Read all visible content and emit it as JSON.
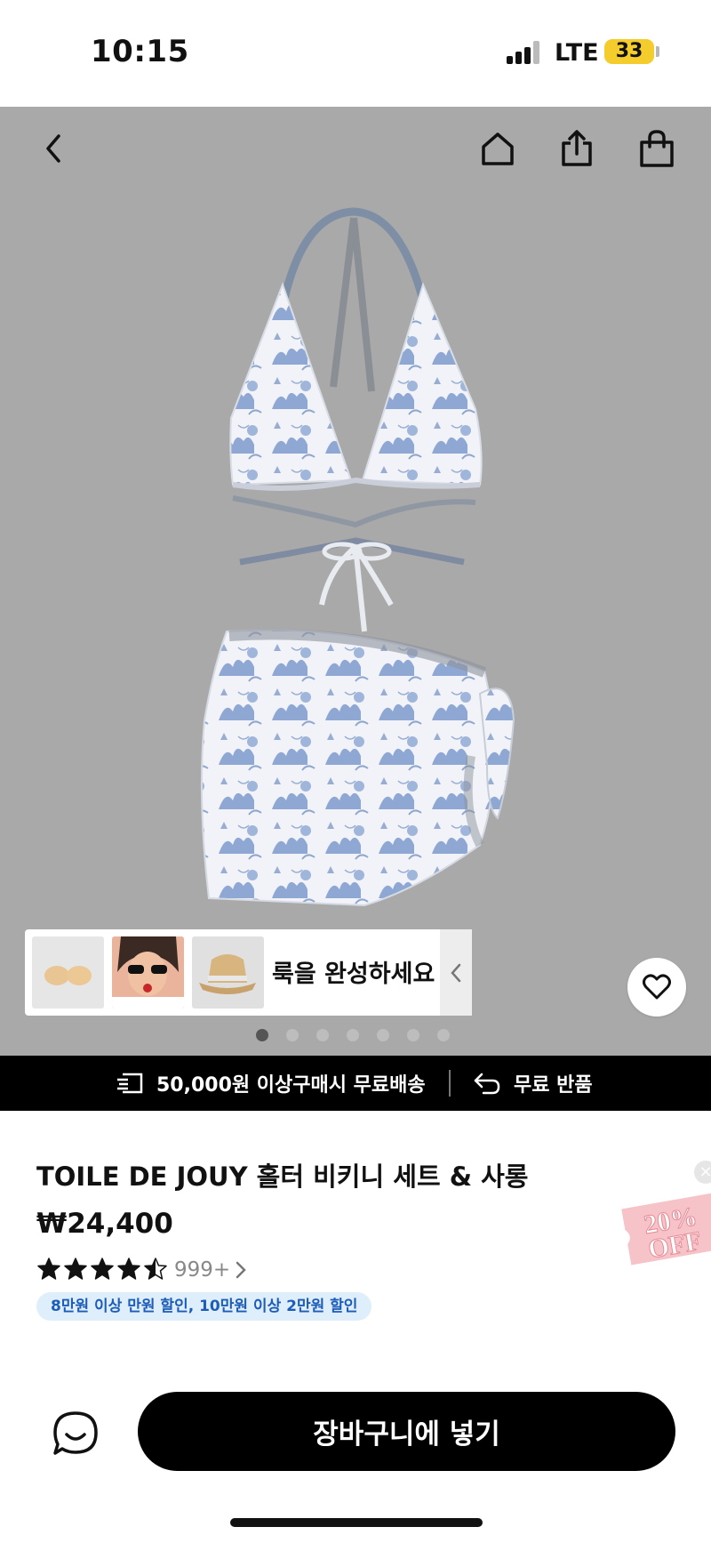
{
  "status_bar": {
    "time": "10:15",
    "network": "LTE",
    "battery": "33"
  },
  "nav": {
    "back_icon": "chevron-left-icon",
    "home_icon": "home-icon",
    "share_icon": "share-icon",
    "bag_icon": "shopping-bag-icon"
  },
  "outfit_strip": {
    "label": "룩을 완성하세요",
    "thumbnails": [
      "nude-bra-pads",
      "model-with-sunglasses",
      "straw-bucket-hat"
    ]
  },
  "carousel": {
    "total": 7,
    "active_index": 0
  },
  "promo": {
    "shipping": "50,000원 이상구매시 무료배송",
    "returns": "무료 반품"
  },
  "product": {
    "title": "TOILE DE JOUY 홀터 비키니 세트 & 사롱",
    "price": "₩24,400",
    "rating": 4.5,
    "reviews": "999+",
    "discount": "8만원 이상 만원 할인, 10만원 이상 2만원 할인"
  },
  "coupon": {
    "line1": "20%",
    "line2": "OFF"
  },
  "actions": {
    "add_to_cart": "장바구니에 넣기"
  },
  "colors": {
    "hero_bg": "#a9a9a9",
    "print_blue": "#5b7fb8",
    "discount_text": "#1d5db8",
    "discount_bg": "#deeefb",
    "battery": "#f4cc2c"
  }
}
